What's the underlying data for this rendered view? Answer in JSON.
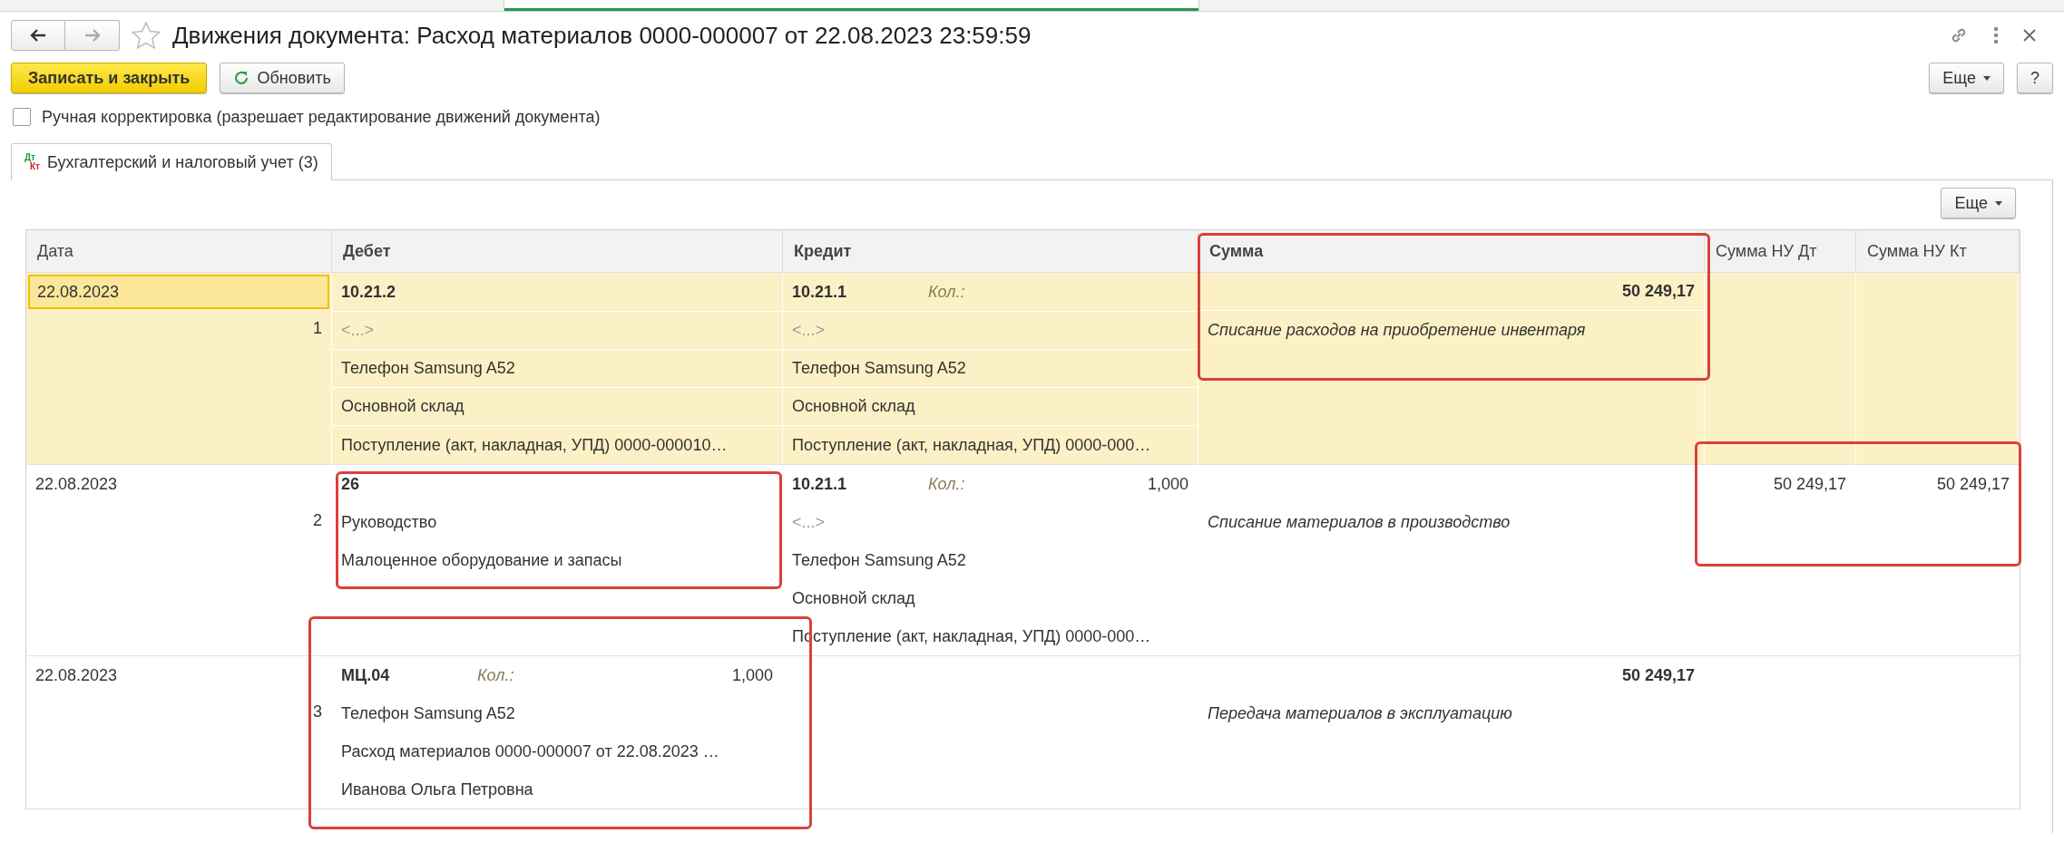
{
  "window": {
    "title": "Движения документа: Расход материалов 0000-000007 от 22.08.2023 23:59:59"
  },
  "toolbar": {
    "primary": "Записать и закрыть",
    "refresh": "Обновить",
    "more": "Еще",
    "help": "?"
  },
  "manual_edit": {
    "label": "Ручная корректировка (разрешает редактирование движений документа)",
    "checked": false
  },
  "tabs": [
    {
      "icon_top": "Дт",
      "icon_bottom": "Кт",
      "label": "Бухгалтерский и налоговый учет (3)",
      "selected": true
    }
  ],
  "table_more": "Еще",
  "table": {
    "columns": [
      "Дата",
      "Дебет",
      "Кредит",
      "Сумма",
      "Сумма НУ Дт",
      "Сумма НУ Кт"
    ],
    "rows": [
      {
        "selected": true,
        "date": "22.08.2023",
        "number": "1",
        "debit": {
          "account": "10.21.2",
          "lines": [
            {
              "kind": "empty",
              "text": "<...>"
            },
            {
              "kind": "text",
              "text": "Телефон Samsung A52"
            },
            {
              "kind": "text",
              "text": "Основной склад"
            },
            {
              "kind": "text",
              "text": "Поступление (акт, накладная, УПД) 0000-000010…"
            }
          ]
        },
        "credit": {
          "account": "10.21.1",
          "qty_label": "Кол.:",
          "lines": [
            {
              "kind": "empty",
              "text": "<...>"
            },
            {
              "kind": "text",
              "text": "Телефон Samsung A52"
            },
            {
              "kind": "text",
              "text": "Основной склад"
            },
            {
              "kind": "text",
              "text": "Поступление (акт, накладная, УПД) 0000-000…"
            }
          ]
        },
        "sum": "50 249,17",
        "comment": "Списание расходов на приобретение инвентаря"
      },
      {
        "selected": false,
        "date": "22.08.2023",
        "number": "2",
        "debit": {
          "account": "26",
          "lines": [
            {
              "kind": "text",
              "text": "Руководство"
            },
            {
              "kind": "text",
              "text": "Малоценное оборудование и запасы"
            }
          ]
        },
        "credit": {
          "account": "10.21.1",
          "qty_label": "Кол.:",
          "qty": "1,000",
          "lines": [
            {
              "kind": "empty",
              "text": "<...>"
            },
            {
              "kind": "text",
              "text": "Телефон Samsung A52"
            },
            {
              "kind": "text",
              "text": "Основной склад"
            },
            {
              "kind": "text",
              "text": "Поступление (акт, накладная, УПД) 0000-000…"
            }
          ]
        },
        "comment": "Списание материалов в производство",
        "nu_dt": "50 249,17",
        "nu_kt": "50 249,17"
      },
      {
        "selected": false,
        "date": "22.08.2023",
        "number": "3",
        "debit": {
          "account": "МЦ.04",
          "qty_label": "Кол.:",
          "qty": "1,000",
          "lines": [
            {
              "kind": "text",
              "text": "Телефон Samsung A52"
            },
            {
              "kind": "text",
              "text": "Расход материалов 0000-000007 от 22.08.2023 …"
            },
            {
              "kind": "text",
              "text": "Иванова Ольга Петровна"
            }
          ]
        },
        "sum": "50 249,17",
        "comment": "Передача материалов в эксплуатацию"
      }
    ]
  }
}
